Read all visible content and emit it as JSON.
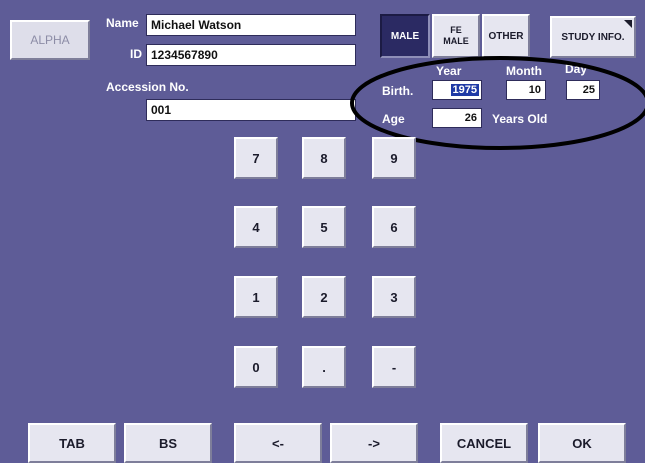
{
  "alpha_label": "ALPHA",
  "patient": {
    "name_label": "Name",
    "name_value": "Michael Watson",
    "id_label": "ID",
    "id_value": "1234567890",
    "accession_label": "Accession No.",
    "accession_value": "001"
  },
  "gender": {
    "male_label": "MALE",
    "female_label_line1": "FE",
    "female_label_line2": "MALE",
    "other_label": "OTHER",
    "selected": "MALE"
  },
  "study_info_label": "STUDY INFO.",
  "birth": {
    "year_label": "Year",
    "month_label": "Month",
    "day_label": "Day",
    "birth_label": "Birth.",
    "year_value": "1975",
    "month_value": "10",
    "day_value": "25",
    "age_label": "Age",
    "age_value": "26",
    "age_unit": "Years Old"
  },
  "keypad": {
    "keys": [
      "7",
      "8",
      "9",
      "4",
      "5",
      "6",
      "1",
      "2",
      "3",
      "0",
      ".",
      "-"
    ]
  },
  "bottom_bar": {
    "tab_label": "TAB",
    "bs_label": "BS",
    "left_label": "<-",
    "right_label": "->",
    "cancel_label": "CANCEL",
    "ok_label": "OK"
  },
  "colors": {
    "background": "#5e5c97",
    "button_face": "#e6e6f0",
    "selected_button": "#2b2a63",
    "highlight_selection": "#1f3aa6",
    "annotation_ellipse": "#000000"
  }
}
